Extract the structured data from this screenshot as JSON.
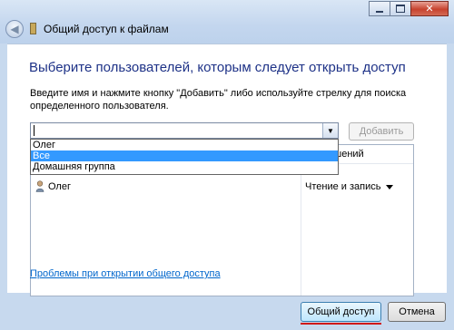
{
  "window": {
    "title": "Общий доступ к файлам",
    "controls": {
      "minimize": "minimize-icon",
      "maximize": "maximize-icon",
      "close": "close-icon"
    }
  },
  "main": {
    "heading": "Выберите пользователей, которым следует открыть доступ",
    "instruction": "Введите имя и нажмите кнопку \"Добавить\" либо используйте стрелку для поиска определенного пользователя.",
    "combo": {
      "value": ""
    },
    "add_button": "Добавить",
    "list": {
      "column_permissions": "разрешений",
      "rows": [
        {
          "name": "Олег",
          "permission": "Чтение и запись"
        }
      ]
    },
    "dropdown_options": [
      {
        "label": "Олег",
        "selected": false
      },
      {
        "label": "Все",
        "selected": true
      },
      {
        "label": "Домашняя группа",
        "selected": false
      }
    ],
    "help_link": "Проблемы при открытии общего доступа"
  },
  "footer": {
    "share_button": "Общий доступ",
    "cancel_button": "Отмена"
  },
  "colors": {
    "heading": "#1e3287",
    "link": "#0066cc",
    "selection": "#3399ff",
    "highlight_underline": "#d01818"
  }
}
